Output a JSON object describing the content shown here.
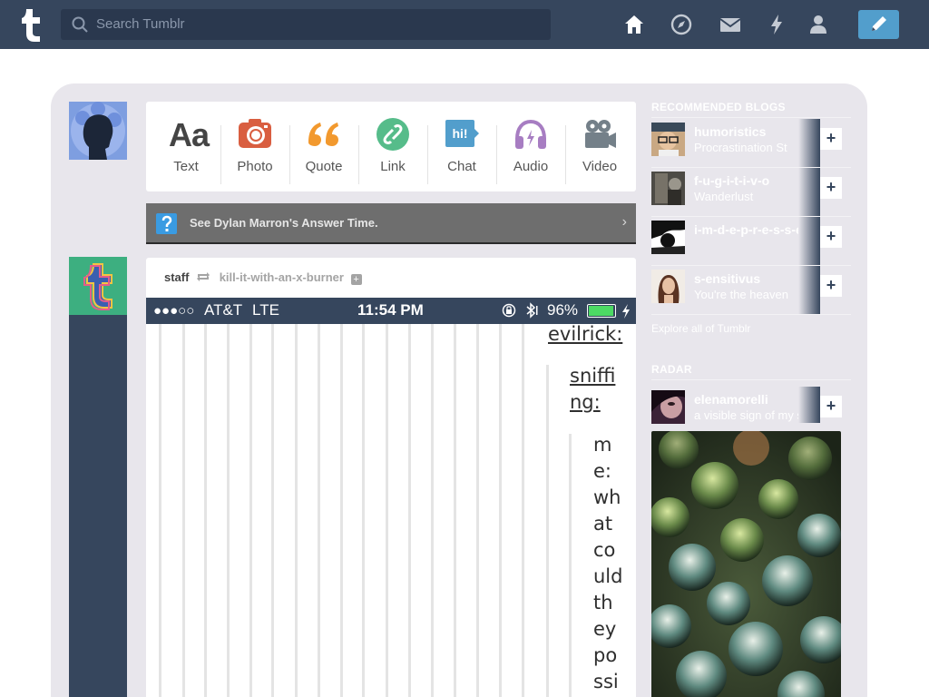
{
  "header": {
    "search_placeholder": "Search Tumblr",
    "nav_icons": [
      "home-icon",
      "explore-icon",
      "inbox-icon",
      "activity-icon",
      "account-icon"
    ],
    "compose_icon": "pencil-icon",
    "colors": {
      "navy": "#36465d",
      "blue": "#529ecc"
    }
  },
  "post_types": [
    {
      "label": "Text",
      "icon": "text-icon",
      "color": "#444444"
    },
    {
      "label": "Photo",
      "icon": "camera-icon",
      "color": "#d95e40"
    },
    {
      "label": "Quote",
      "icon": "quote-icon",
      "color": "#f2992e"
    },
    {
      "label": "Link",
      "icon": "link-icon",
      "color": "#56bc8a"
    },
    {
      "label": "Chat",
      "icon": "chat-icon",
      "color": "#529ecc"
    },
    {
      "label": "Audio",
      "icon": "headphones-icon",
      "color": "#a77dc2"
    },
    {
      "label": "Video",
      "icon": "video-icon",
      "color": "#748089"
    }
  ],
  "answer_time": {
    "text": "See Dylan Marron's Answer Time."
  },
  "post": {
    "author": "staff",
    "reblogged_from": "kill-it-with-an-x-burner",
    "status_bar": {
      "signal": "●●●○○",
      "carrier": "AT&T",
      "network": "LTE",
      "time": "11:54 PM",
      "battery": "96%"
    },
    "lines": [
      "evilrick:",
      "sniffi",
      "ng:",
      "m",
      "e:",
      "wh",
      "at",
      "co",
      "uld",
      "th",
      "ey",
      "po",
      "ssi"
    ]
  },
  "sidebar": {
    "recommended_title": "RECOMMENDED BLOGS",
    "blogs": [
      {
        "name": "humoristics",
        "desc": "Procrastination St"
      },
      {
        "name": "f-u-g-i-t-i-v-o",
        "desc": "Wanderlust"
      },
      {
        "name": "i-m-d-e-p-r-e-s-s-e",
        "desc": ""
      },
      {
        "name": "s-ensitivus",
        "desc": "You're the heaven"
      }
    ],
    "explore_link": "Explore all of Tumblr",
    "radar_title": "RADAR",
    "radar_blog": {
      "name": "elenamorelli",
      "desc": "a visible sign of my s"
    }
  }
}
